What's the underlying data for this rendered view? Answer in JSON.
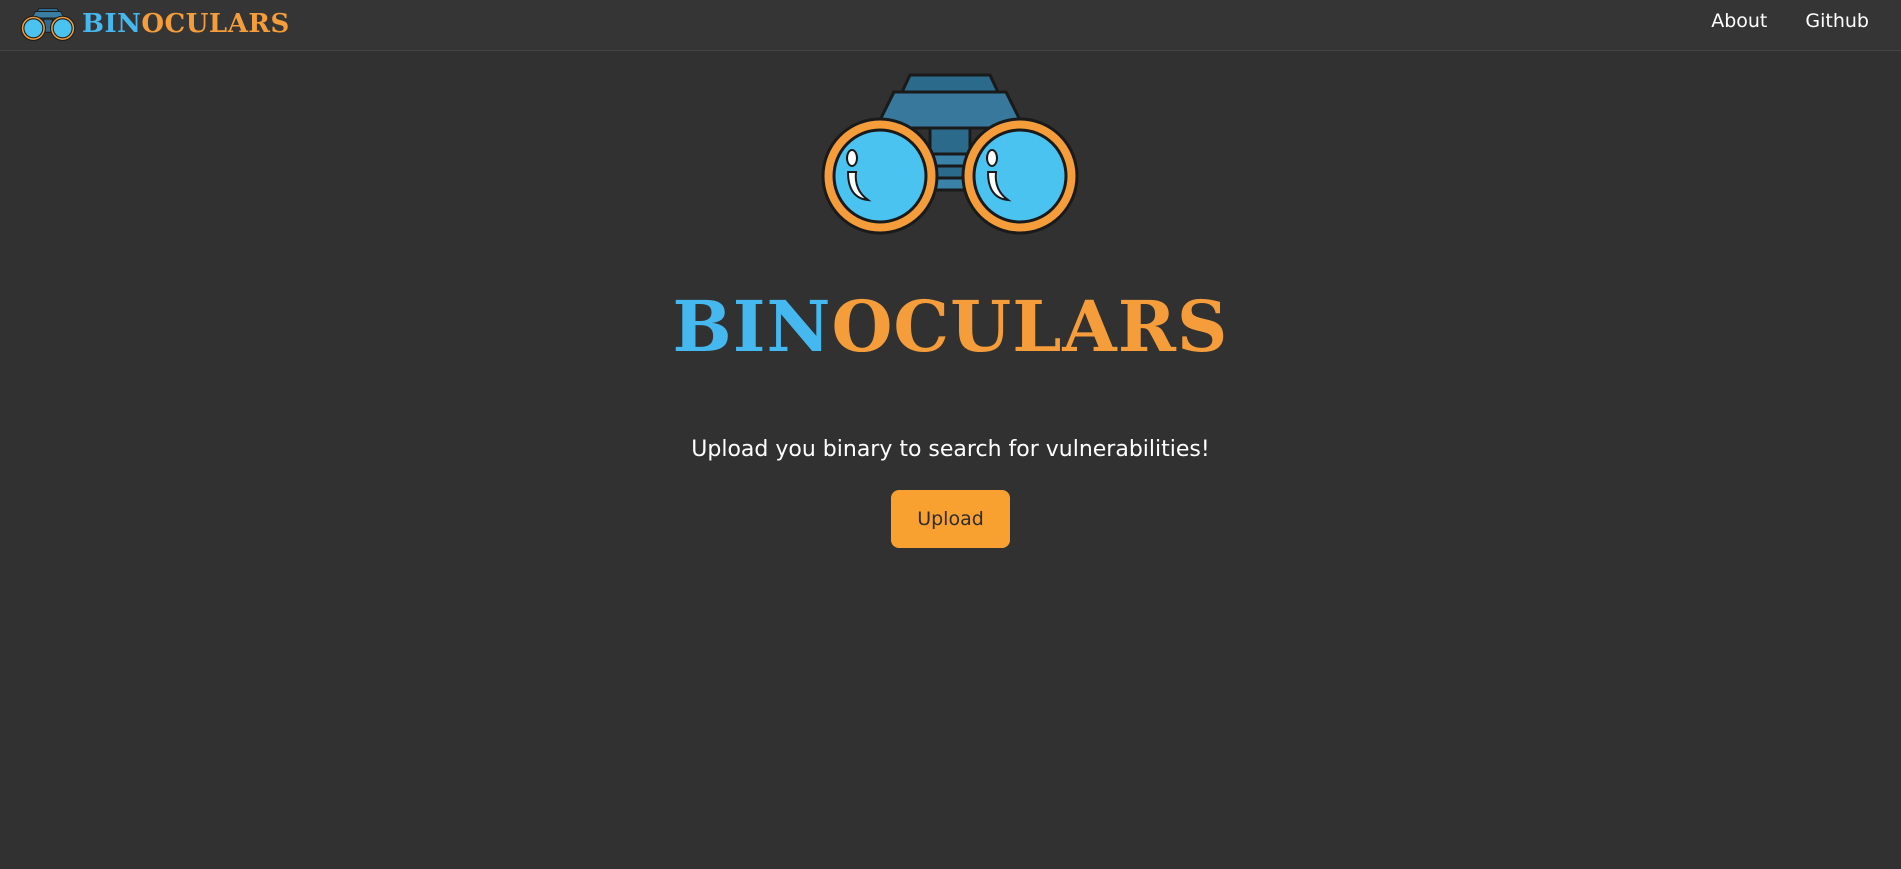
{
  "brand": {
    "name_part1": "BIN",
    "name_part2": "OCULARS",
    "logo_icon": "binoculars-icon"
  },
  "nav": {
    "links": [
      {
        "label": "About"
      },
      {
        "label": "Github"
      }
    ]
  },
  "hero": {
    "logo_icon": "binoculars-icon",
    "title_part1": "BIN",
    "title_part2": "OCULARS",
    "subtitle": "Upload you binary to search for vulnerabilities!",
    "upload_label": "Upload"
  },
  "colors": {
    "background": "#313131",
    "navbar": "#353535",
    "accent_blue": "#45b9ef",
    "accent_orange": "#f59d3a",
    "button": "#f9a130"
  }
}
